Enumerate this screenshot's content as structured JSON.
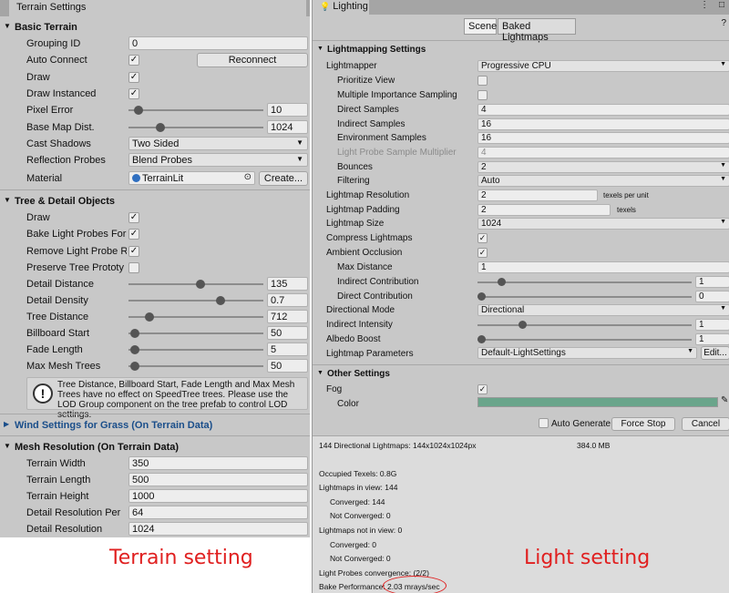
{
  "terrain": {
    "tab_title": "Terrain Settings",
    "basic": {
      "header": "Basic Terrain",
      "grouping_id": {
        "label": "Grouping ID",
        "value": "0"
      },
      "auto_connect": {
        "label": "Auto Connect",
        "checked": true
      },
      "reconnect_button": "Reconnect",
      "draw": {
        "label": "Draw",
        "checked": true
      },
      "draw_instanced": {
        "label": "Draw Instanced",
        "checked": true
      },
      "pixel_error": {
        "label": "Pixel Error",
        "value": "10",
        "fraction": 0.05
      },
      "base_map_dist": {
        "label": "Base Map Dist.",
        "value": "1024",
        "fraction": 0.2
      },
      "cast_shadows": {
        "label": "Cast Shadows",
        "value": "Two Sided"
      },
      "reflection_probes": {
        "label": "Reflection Probes",
        "value": "Blend Probes"
      },
      "material": {
        "label": "Material",
        "value": "TerrainLit",
        "create_button": "Create..."
      }
    },
    "tree_detail": {
      "header": "Tree & Detail Objects",
      "draw": {
        "label": "Draw",
        "checked": true
      },
      "bake_light_probes": {
        "label": "Bake Light Probes For",
        "checked": true
      },
      "remove_light_probe": {
        "label": "Remove Light Probe R",
        "checked": true
      },
      "preserve_tree": {
        "label": "Preserve Tree Prototy",
        "checked": false
      },
      "detail_distance": {
        "label": "Detail Distance",
        "value": "135",
        "fraction": 0.54
      },
      "detail_density": {
        "label": "Detail Density",
        "value": "0.7",
        "fraction": 0.7
      },
      "tree_distance": {
        "label": "Tree Distance",
        "value": "712",
        "fraction": 0.15
      },
      "billboard_start": {
        "label": "Billboard Start",
        "value": "50",
        "fraction": 0.03
      },
      "fade_length": {
        "label": "Fade Length",
        "value": "5",
        "fraction": 0.03
      },
      "max_mesh_trees": {
        "label": "Max Mesh Trees",
        "value": "50",
        "fraction": 0.03
      },
      "help_text": "Tree Distance, Billboard Start, Fade Length and Max Mesh Trees have no effect on SpeedTree trees. Please use the LOD Group component on the tree prefab to control LOD settings."
    },
    "wind_header": "Wind Settings for Grass (On Terrain Data)",
    "mesh": {
      "header": "Mesh Resolution (On Terrain Data)",
      "terrain_width": {
        "label": "Terrain Width",
        "value": "350"
      },
      "terrain_length": {
        "label": "Terrain Length",
        "value": "500"
      },
      "terrain_height": {
        "label": "Terrain Height",
        "value": "1000"
      },
      "detail_resolution_per": {
        "label": "Detail Resolution Per",
        "value": "64"
      },
      "detail_resolution": {
        "label": "Detail Resolution",
        "value": "1024"
      }
    },
    "caption": "Terrain setting"
  },
  "lighting": {
    "tab_title": "Lighting",
    "tabs": [
      "Scene",
      "Baked Lightmaps"
    ],
    "lightmapping": {
      "header": "Lightmapping Settings",
      "lightmapper": {
        "label": "Lightmapper",
        "value": "Progressive CPU"
      },
      "prioritize_view": {
        "label": "Prioritize View",
        "checked": false
      },
      "mis": {
        "label": "Multiple Importance Sampling",
        "checked": false
      },
      "direct_samples": {
        "label": "Direct Samples",
        "value": "4"
      },
      "indirect_samples": {
        "label": "Indirect Samples",
        "value": "16"
      },
      "environment_samples": {
        "label": "Environment Samples",
        "value": "16"
      },
      "light_probe_multiplier": {
        "label": "Light Probe Sample Multiplier",
        "value": "4"
      },
      "bounces": {
        "label": "Bounces",
        "value": "2"
      },
      "filtering": {
        "label": "Filtering",
        "value": "Auto"
      },
      "lightmap_resolution": {
        "label": "Lightmap Resolution",
        "value": "2",
        "unit": "texels per unit"
      },
      "lightmap_padding": {
        "label": "Lightmap Padding",
        "value": "2",
        "unit": "texels"
      },
      "lightmap_size": {
        "label": "Lightmap Size",
        "value": "1024"
      },
      "compress_lightmaps": {
        "label": "Compress Lightmaps",
        "checked": true
      },
      "ambient_occlusion": {
        "label": "Ambient Occlusion",
        "checked": true
      },
      "max_distance": {
        "label": "Max Distance",
        "value": "1"
      },
      "indirect_contribution": {
        "label": "Indirect Contribution",
        "value": "1",
        "fraction": 0.1
      },
      "direct_contribution": {
        "label": "Direct Contribution",
        "value": "0",
        "fraction": 0.0
      },
      "directional_mode": {
        "label": "Directional Mode",
        "value": "Directional"
      },
      "indirect_intensity": {
        "label": "Indirect Intensity",
        "value": "1",
        "fraction": 0.2
      },
      "albedo_boost": {
        "label": "Albedo Boost",
        "value": "1",
        "fraction": 0.0
      },
      "lightmap_parameters": {
        "label": "Lightmap Parameters",
        "value": "Default-LightSettings",
        "edit_button": "Edit..."
      }
    },
    "other": {
      "header": "Other Settings",
      "fog": {
        "label": "Fog",
        "checked": true
      },
      "color": {
        "label": "Color",
        "swatch": "#6aa58b"
      }
    },
    "auto_generate": {
      "label": "Auto Generate",
      "checked": false
    },
    "force_stop_button": "Force Stop",
    "cancel_button": "Cancel",
    "stats": {
      "lightmaps_summary": "144 Directional Lightmaps: 144x1024x1024px",
      "lightmaps_size": "384.0 MB",
      "occupied_texels": "Occupied Texels: 0.8G",
      "in_view": "Lightmaps in view: 144",
      "in_view_converged": "Converged: 144",
      "in_view_not_converged": "Not Converged: 0",
      "not_in_view": "Lightmaps not in view: 0",
      "not_in_view_converged": "Converged: 0",
      "not_in_view_not_converged": "Not Converged: 0",
      "probes_convergence": "Light Probes convergence: (2/2)",
      "bake_performance_label": "Bake Performance:",
      "bake_performance_value": "2.03 mrays/sec"
    },
    "caption": "Light setting"
  },
  "colors": {
    "caption_red": "#e02020",
    "fog_color": "#6aa58b",
    "section_blue": "#1a4e8a"
  }
}
